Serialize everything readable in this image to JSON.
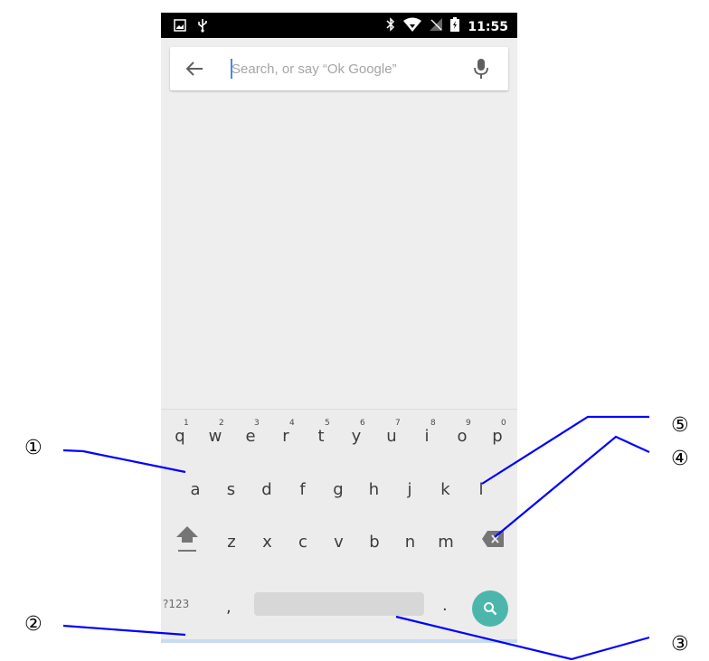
{
  "status_bar": {
    "time": "11:55",
    "left_icons": [
      "image-icon",
      "usb-icon"
    ],
    "right_icons": [
      "bluetooth-icon",
      "wifi-icon",
      "no-signal-icon",
      "battery-charging-icon"
    ]
  },
  "search": {
    "placeholder": "Search, or say “Ok Google”",
    "value": "",
    "back_icon": "back-arrow-icon",
    "mic_icon": "mic-icon"
  },
  "keyboard": {
    "row1": [
      {
        "ch": "q",
        "hint": "1"
      },
      {
        "ch": "w",
        "hint": "2"
      },
      {
        "ch": "e",
        "hint": "3"
      },
      {
        "ch": "r",
        "hint": "4"
      },
      {
        "ch": "t",
        "hint": "5"
      },
      {
        "ch": "y",
        "hint": "6"
      },
      {
        "ch": "u",
        "hint": "7"
      },
      {
        "ch": "i",
        "hint": "8"
      },
      {
        "ch": "o",
        "hint": "9"
      },
      {
        "ch": "p",
        "hint": "0"
      }
    ],
    "row2": [
      "a",
      "s",
      "d",
      "f",
      "g",
      "h",
      "j",
      "k",
      "l"
    ],
    "row3": [
      "z",
      "x",
      "c",
      "v",
      "b",
      "n",
      "m"
    ],
    "numbers_label": "?123",
    "comma": ",",
    "period": ".",
    "accent_color": "#4db6ac"
  },
  "annotations": [
    "①",
    "②",
    "③",
    "④",
    "⑤"
  ],
  "colors": {
    "annotation_line": "#0000ff",
    "cursor": "#4285f4"
  }
}
